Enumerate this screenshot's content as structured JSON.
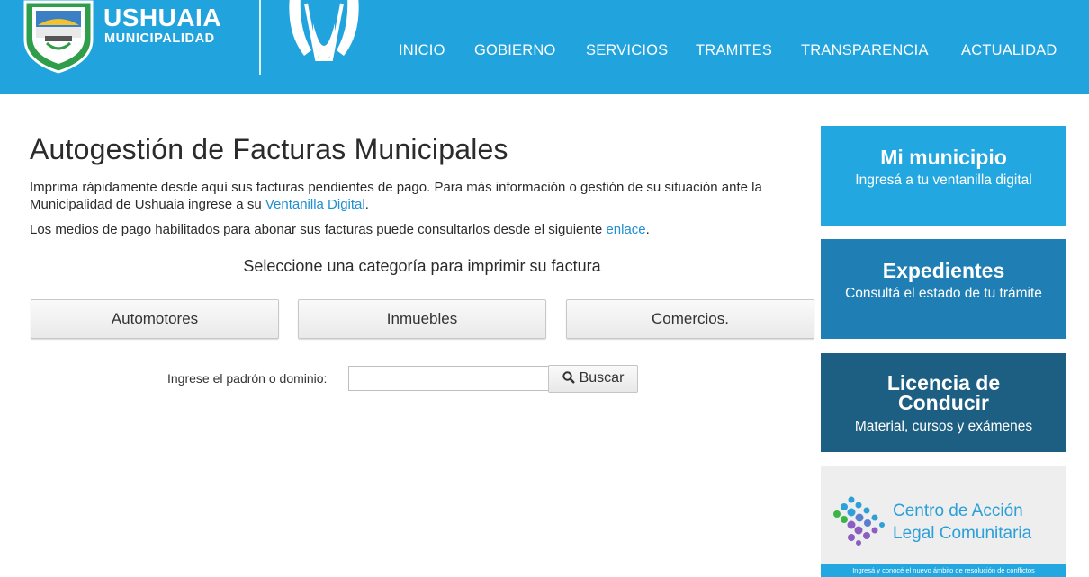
{
  "brand": {
    "title": "USHUAIA",
    "subtitle": "MUNICIPALIDAD"
  },
  "nav": [
    "INICIO",
    "GOBIERNO",
    "SERVICIOS",
    "TRAMITES",
    "TRANSPARENCIA",
    "ACTUALIDAD"
  ],
  "main": {
    "title": "Autogestión de Facturas Municipales",
    "intro_text": "Imprima rápidamente desde aquí sus facturas pendientes de pago. Para más información o gestión de su situación ante la Municipalidad de Ushuaia ingrese a su ",
    "intro_link": "Ventanilla Digital",
    "intro_end": ".",
    "payment_text": "Los medios de pago habilitados para abonar sus facturas puede consultarlos desde el siguiente ",
    "payment_link": "enlace",
    "payment_end": ".",
    "select_label": "Seleccione una categoría para imprimir su factura",
    "categories": [
      "Automotores",
      "Inmuebles",
      "Comercios."
    ],
    "search_label": "Ingrese el padrón o dominio:",
    "search_value": "",
    "search_button": "Buscar"
  },
  "sidebar": {
    "card1": {
      "title": "Mi municipio",
      "subtitle": "Ingresá a tu ventanilla digital"
    },
    "card2": {
      "title": "Expedientes",
      "subtitle": "Consultá el estado de tu trámite"
    },
    "card3": {
      "title": "Licencia de Conducir",
      "subtitle": "Material, cursos y exámenes"
    },
    "card4": {
      "title_line1": "Centro de Acción",
      "title_line2": "Legal Comunitaria",
      "strip": "Ingresá y conocé el nuevo ámbito de resolución de conflictos"
    }
  },
  "colors": {
    "header": "#21a4de",
    "card1": "#22a7e0",
    "card2": "#1f7fb4",
    "card3": "#1d5f82",
    "link": "#1f8fcf"
  },
  "icons": {
    "search": "magnifier-icon",
    "logo": "shield-icon",
    "emblem": "emblem-icon"
  }
}
